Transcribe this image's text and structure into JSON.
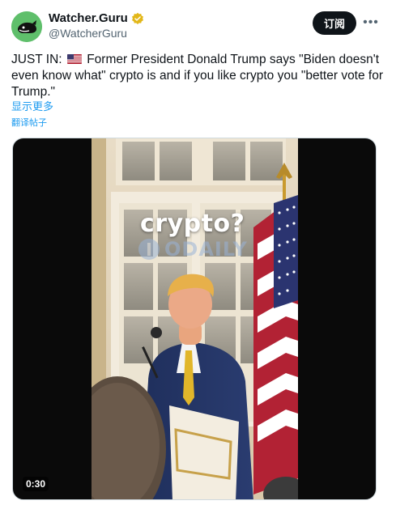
{
  "author": {
    "display_name": "Watcher.Guru",
    "handle": "@WatcherGuru",
    "avatar_icon": "whale-avatar-icon",
    "verified_badge_color": "#e2b719"
  },
  "actions": {
    "subscribe_label": "订阅",
    "more_label": "•••"
  },
  "tweet": {
    "text_before_flag": "JUST IN: ",
    "flag_icon": "us-flag-icon",
    "text_after_flag": " Former President Donald Trump says \"Biden doesn't even know what\" crypto is and if you like crypto you \"better vote for Trump.\"",
    "show_more": "显示更多",
    "translate": "翻译帖子"
  },
  "media": {
    "overlay_text": "crypto?",
    "watermark_text": "ODAILY",
    "duration": "0:30"
  },
  "colors": {
    "link": "#1d9bf0",
    "text": "#0f1419",
    "secondary": "#536471",
    "avatar_bg": "#5fbf6b"
  }
}
